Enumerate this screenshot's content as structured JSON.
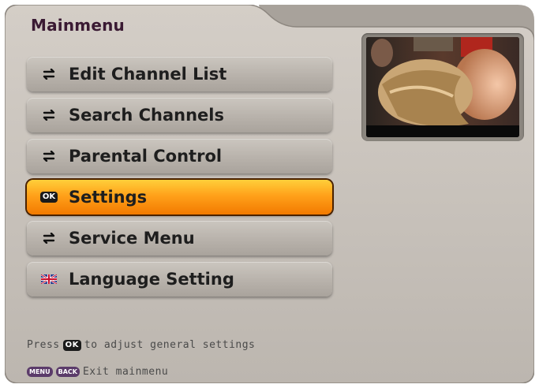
{
  "window": {
    "title": "Mainmenu"
  },
  "menu": {
    "items": [
      {
        "label": "Edit Channel List",
        "icon": "arrow-swap-icon",
        "selected": false
      },
      {
        "label": "Search Channels",
        "icon": "arrow-swap-icon",
        "selected": false
      },
      {
        "label": "Parental Control",
        "icon": "arrow-swap-icon",
        "selected": false
      },
      {
        "label": "Settings",
        "icon": "ok-icon",
        "selected": true
      },
      {
        "label": "Service Menu",
        "icon": "arrow-swap-icon",
        "selected": false
      },
      {
        "label": "Language Setting",
        "icon": "uk-flag-icon",
        "selected": false
      }
    ]
  },
  "footer": {
    "help_prefix": "Press",
    "help_key": "OK",
    "help_suffix": "to adjust general settings",
    "key_menu": "MENU",
    "key_back": "BACK",
    "exit_text": "Exit mainmenu"
  },
  "colors": {
    "background": "#c7c1ba",
    "selected": "#ff9a12",
    "title": "#3a1a33"
  }
}
